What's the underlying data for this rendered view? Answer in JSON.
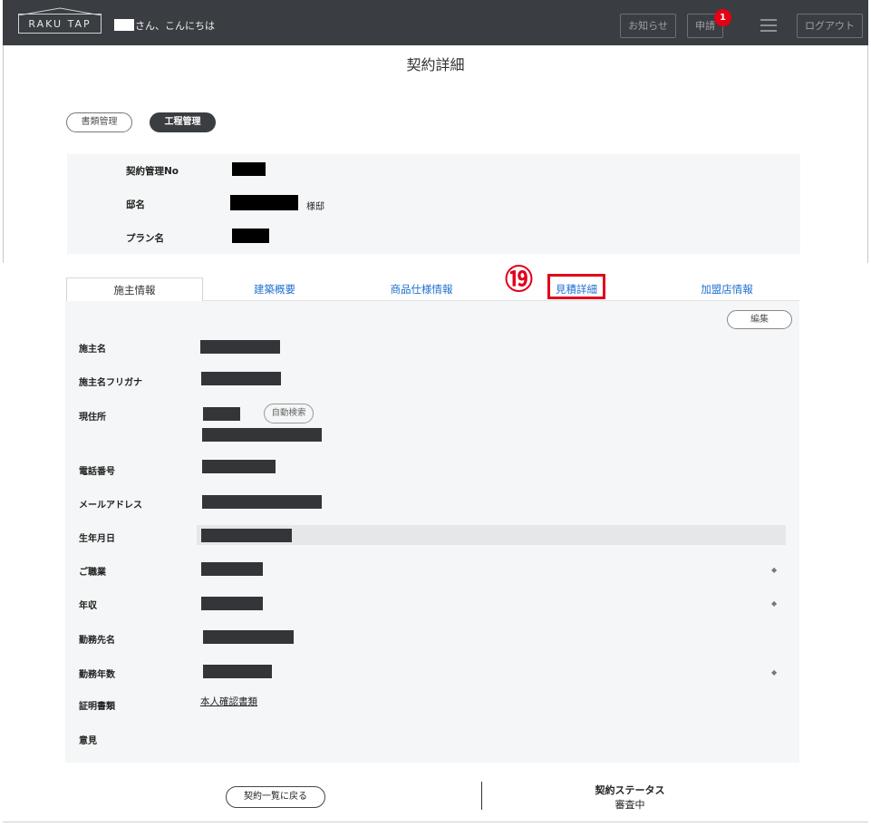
{
  "header": {
    "logo_text": "RAKU TAP",
    "greeting": "さん、こんにちは",
    "notice_label": "お知らせ",
    "apply_label": "申請",
    "apply_badge": "1",
    "menu_icon": "hamburger-icon",
    "logout_label": "ログアウト"
  },
  "page": {
    "title": "契約詳細"
  },
  "section_tabs": {
    "documents": "書類管理",
    "process": "工程管理"
  },
  "summary": {
    "contract_no_label": "契約管理No",
    "house_name_label": "邸名",
    "honorific": "様邸",
    "plan_name_label": "プラン名"
  },
  "tabs": [
    {
      "label": "施主情報",
      "active": true
    },
    {
      "label": "建築概要",
      "active": false
    },
    {
      "label": "商品仕様情報",
      "active": false
    },
    {
      "label": "見積詳細",
      "active": false
    },
    {
      "label": "加盟店情報",
      "active": false
    }
  ],
  "annotation": {
    "number": "⑲",
    "color": "#e0001b"
  },
  "owner_info": {
    "edit_label": "編集",
    "fields": [
      {
        "label": "施主名"
      },
      {
        "label": "施主名フリガナ"
      },
      {
        "label": "現住所",
        "button": "自動検索"
      },
      {
        "label": "電話番号"
      },
      {
        "label": "メールアドレス"
      },
      {
        "label": "生年月日"
      },
      {
        "label": "ご職業"
      },
      {
        "label": "年収"
      },
      {
        "label": "勤務先名"
      },
      {
        "label": "勤務年数"
      },
      {
        "label": "証明書類",
        "link": "本人確認書類"
      },
      {
        "label": "意見"
      }
    ]
  },
  "footer": {
    "back_label": "契約一覧に戻る",
    "status_title": "契約ステータス",
    "status_value": "審査中"
  },
  "colors": {
    "topbar": "#3a3d41",
    "link": "#1f6fd1",
    "badge": "#e60012"
  }
}
